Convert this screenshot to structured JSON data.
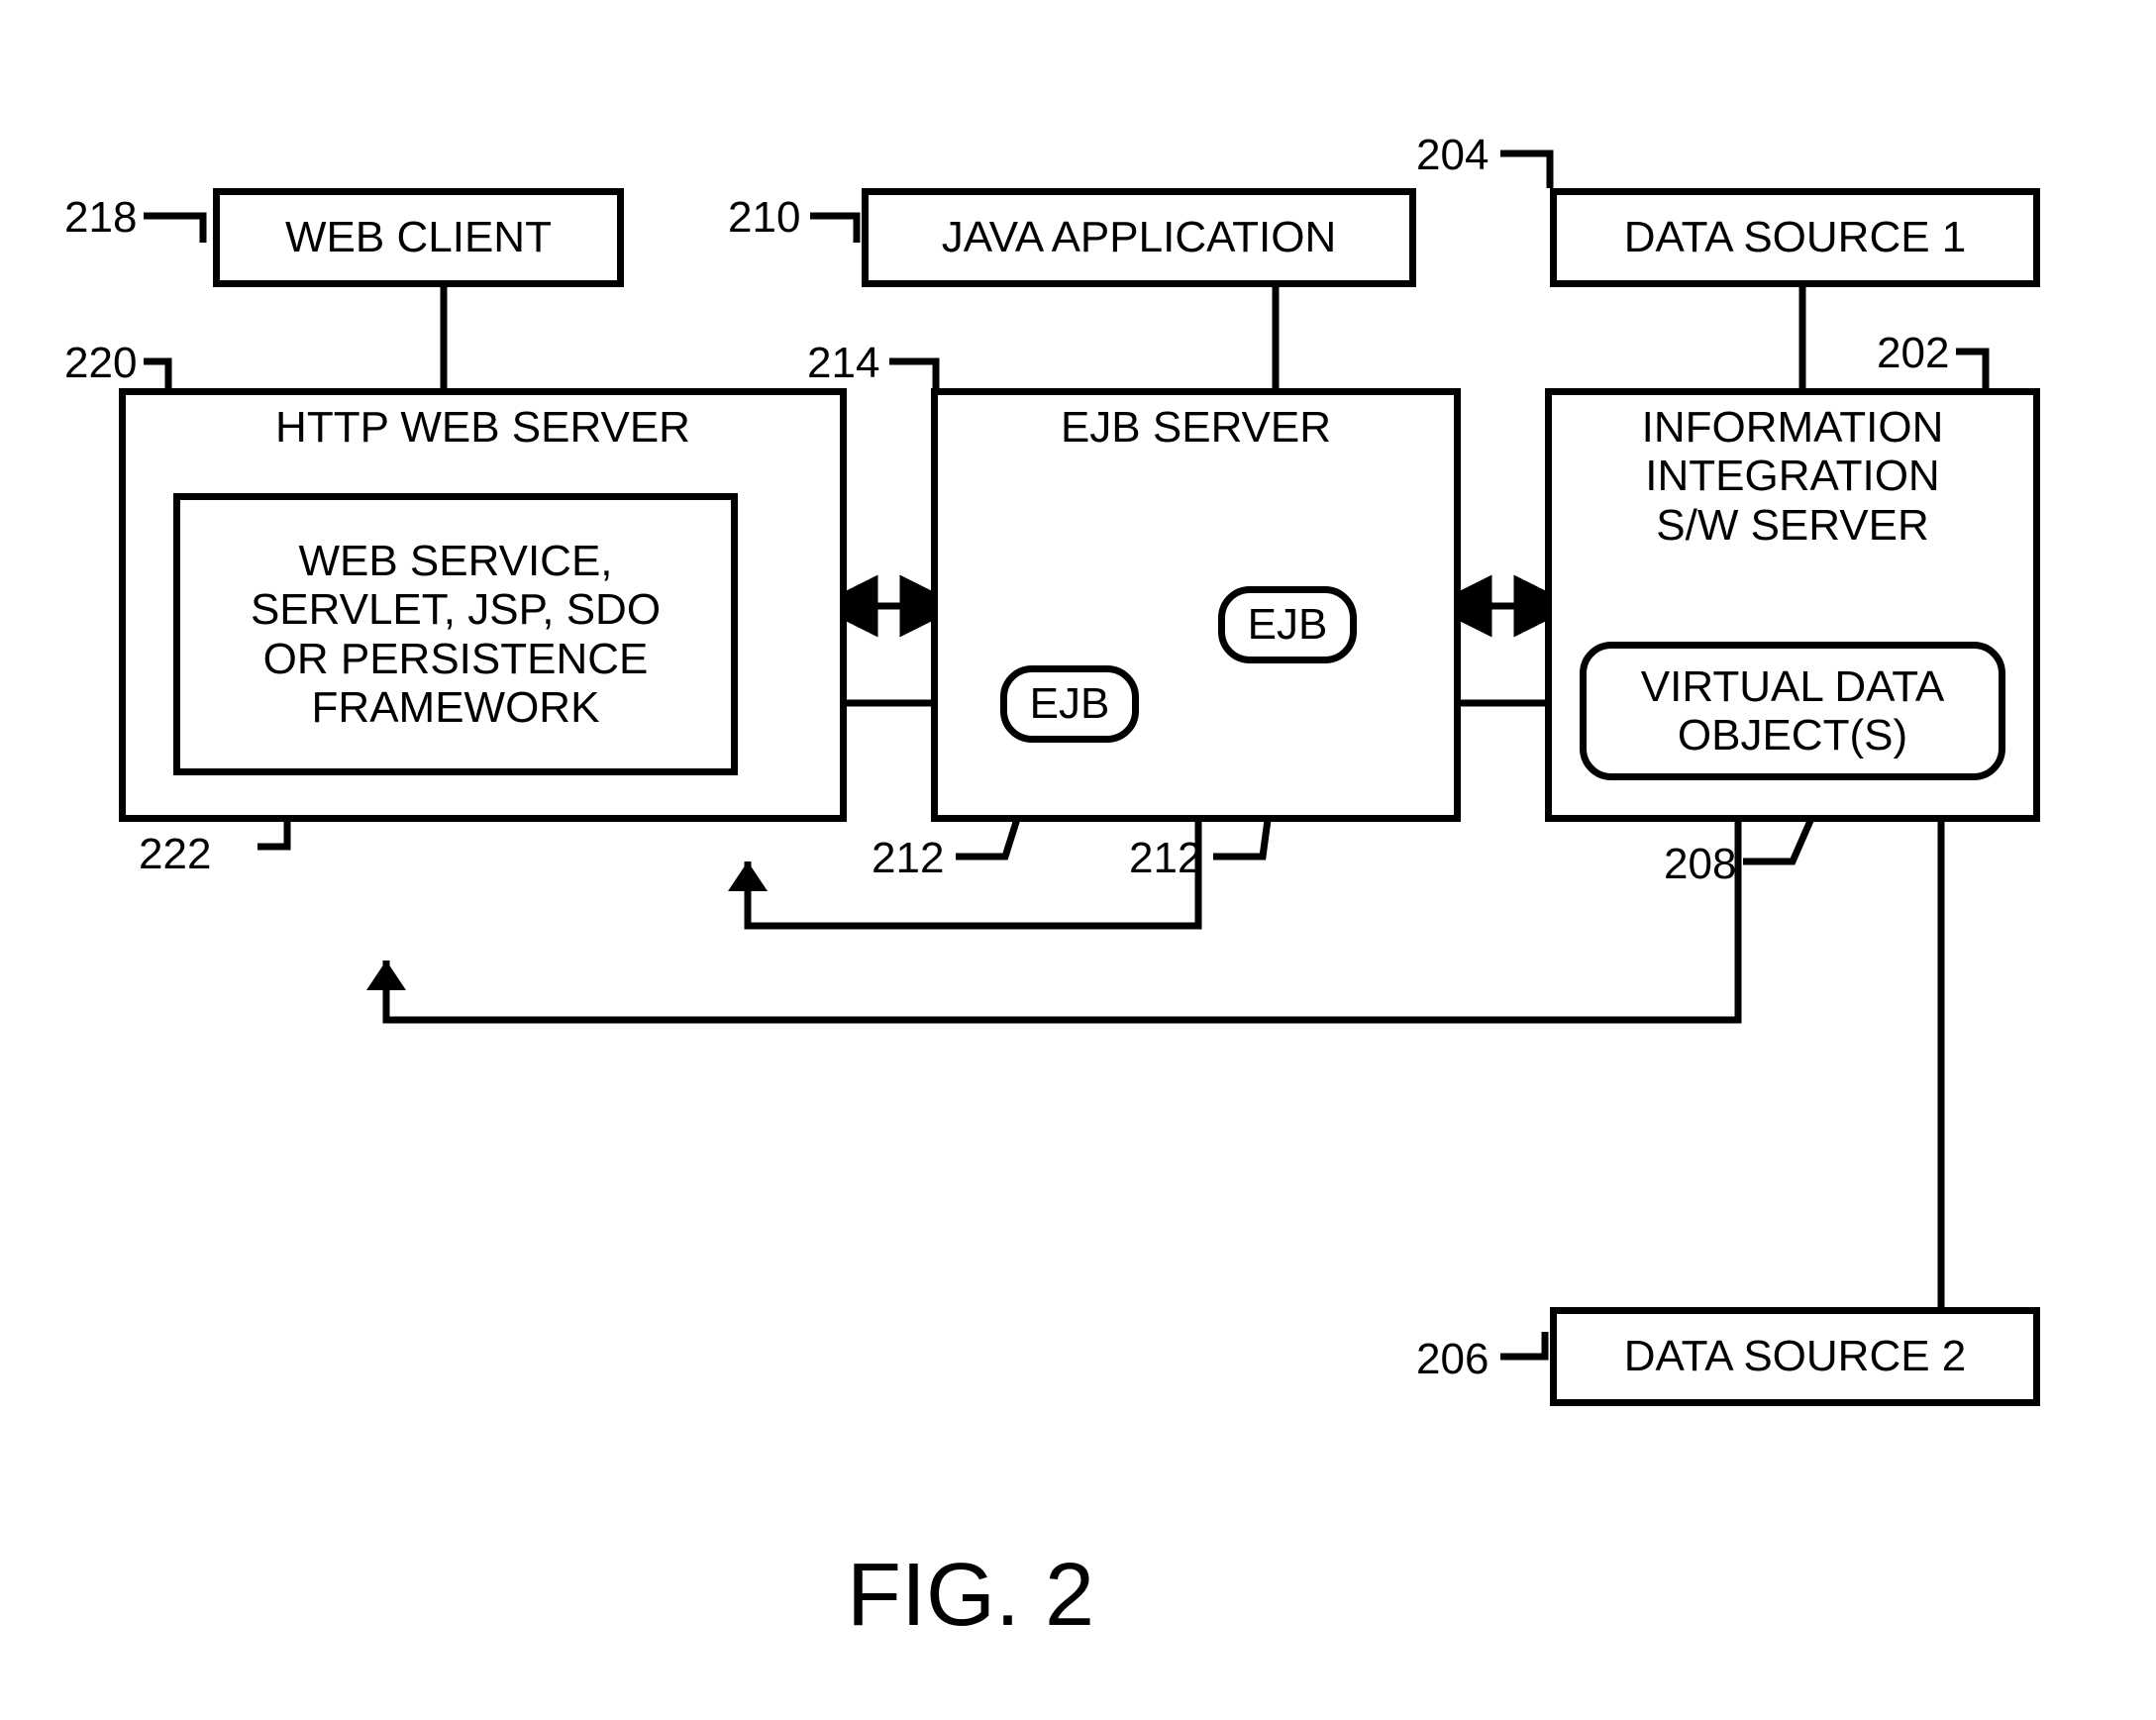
{
  "figure_label": "FIG. 2",
  "refs": {
    "r202": "202",
    "r204": "204",
    "r206": "206",
    "r208": "208",
    "r210": "210",
    "r212a": "212",
    "r212b": "212",
    "r214": "214",
    "r218": "218",
    "r220": "220",
    "r222": "222"
  },
  "blocks": {
    "web_client": "WEB CLIENT",
    "http_server": "HTTP WEB SERVER",
    "web_service": "WEB SERVICE,\nSERVLET, JSP, SDO\nOR PERSISTENCE\nFRAMEWORK",
    "java_app": "JAVA APPLICATION",
    "ejb_server": "EJB SERVER",
    "ejb1": "EJB",
    "ejb2": "EJB",
    "iis": "INFORMATION\nINTEGRATION\nS/W SERVER",
    "vdo": "VIRTUAL DATA\nOBJECT(S)",
    "ds1": "DATA SOURCE 1",
    "ds2": "DATA SOURCE 2"
  }
}
